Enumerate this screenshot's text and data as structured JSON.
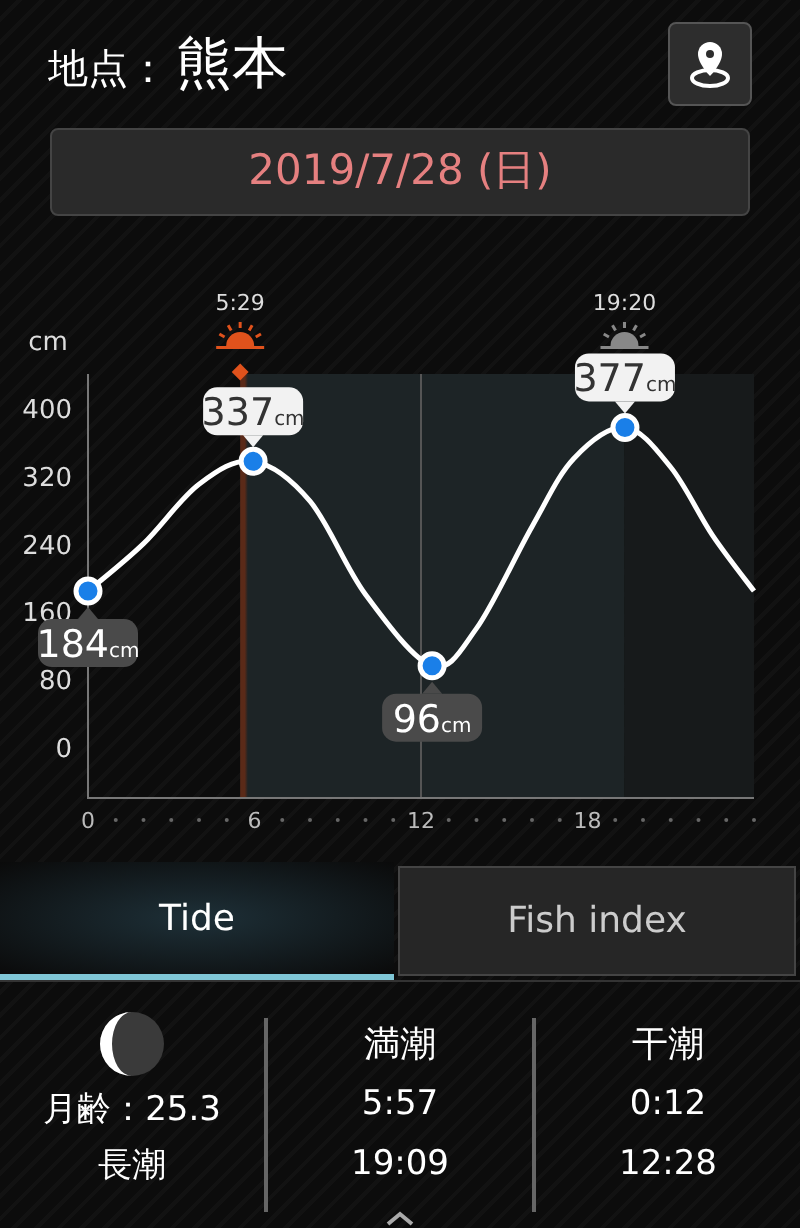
{
  "header": {
    "label": "地点：",
    "location": "熊本"
  },
  "date": "2019/7/28 (日)",
  "chart": {
    "sun_events": [
      {
        "kind": "sunrise",
        "time": "5:29"
      },
      {
        "kind": "sunset",
        "time": "19:20"
      }
    ],
    "point_labels": [
      {
        "value": "184",
        "unit": "cm"
      },
      {
        "value": "337",
        "unit": "cm"
      },
      {
        "value": "96",
        "unit": "cm"
      },
      {
        "value": "377",
        "unit": "cm"
      }
    ],
    "chart_data": {
      "type": "line",
      "ylabel": "cm",
      "x": [
        0,
        2,
        4,
        5.95,
        8,
        10,
        12.4,
        14,
        16,
        17.5,
        19.35,
        21,
        22.5,
        24
      ],
      "series": [
        {
          "color": "#ffffff",
          "values": [
            184,
            240,
            310,
            337,
            290,
            180,
            96,
            140,
            260,
            340,
            377,
            330,
            250,
            184
          ]
        }
      ],
      "xlim": [
        0,
        24
      ],
      "ylim": [
        -60,
        440
      ],
      "xticks": [
        0,
        6,
        12,
        18
      ],
      "yticks": [
        0,
        80,
        160,
        240,
        320,
        400
      ]
    }
  },
  "tabs": [
    {
      "label": "Tide",
      "selected": true
    },
    {
      "label": "Fish index",
      "selected": false
    }
  ],
  "info": {
    "moon_age": "月齢：25.3",
    "tide_name": "長潮",
    "columns": [
      {
        "title": "満潮",
        "times": [
          "5:57",
          "19:09"
        ]
      },
      {
        "title": "干潮",
        "times": [
          "0:12",
          "12:28"
        ]
      }
    ]
  }
}
